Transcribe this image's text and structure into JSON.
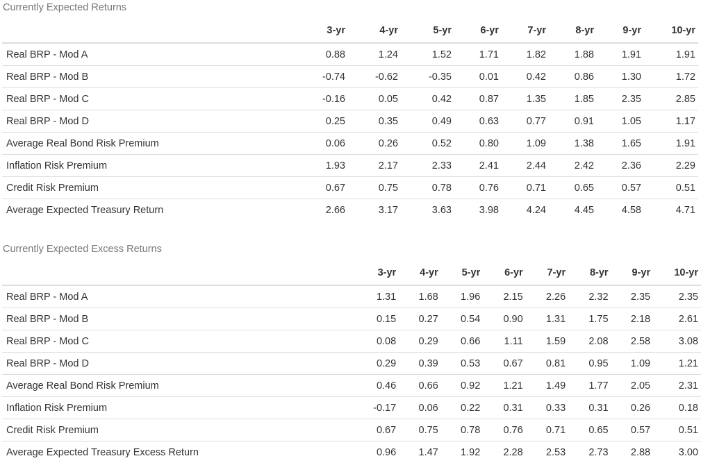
{
  "tables": [
    {
      "caption": "Currently Expected Returns",
      "headers": [
        "",
        "3-yr",
        "4-yr",
        "5-yr",
        "6-yr",
        "7-yr",
        "8-yr",
        "9-yr",
        "10-yr"
      ],
      "rows": [
        [
          "Real BRP - Mod A",
          "0.88",
          "1.24",
          "1.52",
          "1.71",
          "1.82",
          "1.88",
          "1.91",
          "1.91"
        ],
        [
          "Real BRP - Mod B",
          "-0.74",
          "-0.62",
          "-0.35",
          "0.01",
          "0.42",
          "0.86",
          "1.30",
          "1.72"
        ],
        [
          "Real BRP - Mod C",
          "-0.16",
          "0.05",
          "0.42",
          "0.87",
          "1.35",
          "1.85",
          "2.35",
          "2.85"
        ],
        [
          "Real BRP - Mod D",
          "0.25",
          "0.35",
          "0.49",
          "0.63",
          "0.77",
          "0.91",
          "1.05",
          "1.17"
        ],
        [
          "Average Real Bond Risk Premium",
          "0.06",
          "0.26",
          "0.52",
          "0.80",
          "1.09",
          "1.38",
          "1.65",
          "1.91"
        ],
        [
          "Inflation Risk Premium",
          "1.93",
          "2.17",
          "2.33",
          "2.41",
          "2.44",
          "2.42",
          "2.36",
          "2.29"
        ],
        [
          "Credit Risk Premium",
          "0.67",
          "0.75",
          "0.78",
          "0.76",
          "0.71",
          "0.65",
          "0.57",
          "0.51"
        ],
        [
          "Average Expected Treasury Return",
          "2.66",
          "3.17",
          "3.63",
          "3.98",
          "4.24",
          "4.45",
          "4.58",
          "4.71"
        ]
      ]
    },
    {
      "caption": "Currently Expected Excess Returns",
      "headers": [
        "",
        "3-yr",
        "4-yr",
        "5-yr",
        "6-yr",
        "7-yr",
        "8-yr",
        "9-yr",
        "10-yr"
      ],
      "rows": [
        [
          "Real BRP - Mod A",
          "1.31",
          "1.68",
          "1.96",
          "2.15",
          "2.26",
          "2.32",
          "2.35",
          "2.35"
        ],
        [
          "Real BRP - Mod B",
          "0.15",
          "0.27",
          "0.54",
          "0.90",
          "1.31",
          "1.75",
          "2.18",
          "2.61"
        ],
        [
          "Real BRP - Mod C",
          "0.08",
          "0.29",
          "0.66",
          "1.11",
          "1.59",
          "2.08",
          "2.58",
          "3.08"
        ],
        [
          "Real BRP - Mod D",
          "0.29",
          "0.39",
          "0.53",
          "0.67",
          "0.81",
          "0.95",
          "1.09",
          "1.21"
        ],
        [
          "Average Real Bond Risk Premium",
          "0.46",
          "0.66",
          "0.92",
          "1.21",
          "1.49",
          "1.77",
          "2.05",
          "2.31"
        ],
        [
          "Inflation Risk Premium",
          "-0.17",
          "0.06",
          "0.22",
          "0.31",
          "0.33",
          "0.31",
          "0.26",
          "0.18"
        ],
        [
          "Credit Risk Premium",
          "0.67",
          "0.75",
          "0.78",
          "0.76",
          "0.71",
          "0.65",
          "0.57",
          "0.51"
        ],
        [
          "Average Expected Treasury Excess Return",
          "0.96",
          "1.47",
          "1.92",
          "2.28",
          "2.53",
          "2.73",
          "2.88",
          "3.00"
        ]
      ]
    }
  ]
}
